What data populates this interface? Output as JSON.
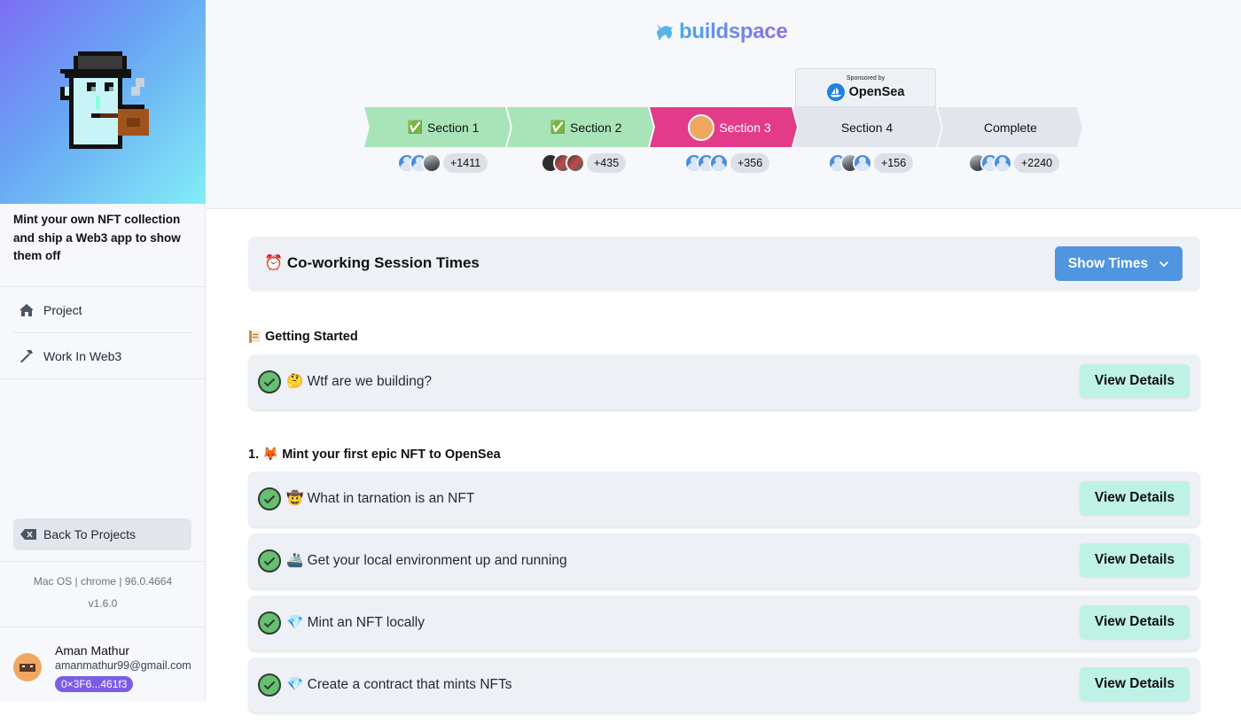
{
  "brand": {
    "name": "buildspace",
    "logo_icon": "unicorn-icon"
  },
  "sidebar": {
    "project_title": "Mint your own NFT collection and ship a Web3 app to show them off",
    "nav": [
      {
        "label": "Project",
        "icon": "home-icon"
      },
      {
        "label": "Work In Web3",
        "icon": "hammer-icon"
      }
    ],
    "back_label": "Back To Projects",
    "system_info": "Mac OS | chrome | 96.0.4664",
    "version": "v1.6.0",
    "user": {
      "name": "Aman Mathur",
      "email": "amanmathur99@gmail.com",
      "wallet": "0×3F6...461f3"
    }
  },
  "sponsor": {
    "label": "Sponsored by",
    "name": "OpenSea"
  },
  "steps": [
    {
      "label": "Section 1",
      "count": "+1411",
      "status": "done",
      "color": "#a8e4b8"
    },
    {
      "label": "Section 2",
      "count": "+435",
      "status": "done",
      "color": "#a8e4b8"
    },
    {
      "label": "Section 3",
      "count": "+356",
      "status": "current",
      "color": "#e33b8a"
    },
    {
      "label": "Section 4",
      "count": "+156",
      "status": "todo",
      "color": "#e2e6ec"
    },
    {
      "label": "Complete",
      "count": "+2240",
      "status": "todo",
      "color": "#e2e6ec"
    }
  ],
  "session": {
    "title": "⏰ Co-working Session Times",
    "button": "Show Times"
  },
  "groups": [
    {
      "title": "Getting Started",
      "lessons": [
        {
          "emoji": "🤔",
          "label": "Wtf are we building?"
        }
      ]
    },
    {
      "title": "1. 🦊 Mint your first epic NFT to OpenSea",
      "lessons": [
        {
          "emoji": "🤠",
          "label": "What in tarnation is an NFT"
        },
        {
          "emoji": "🚢",
          "label": "Get your local environment up and running"
        },
        {
          "emoji": "💎",
          "label": "Mint an NFT locally"
        },
        {
          "emoji": "💎",
          "label": "Create a contract that mints NFTs"
        }
      ]
    }
  ],
  "view_details_label": "View Details",
  "colors": {
    "accent": "#4f95df",
    "view_button": "#bff2e6",
    "wallet_badge": "#7c5ce6"
  }
}
